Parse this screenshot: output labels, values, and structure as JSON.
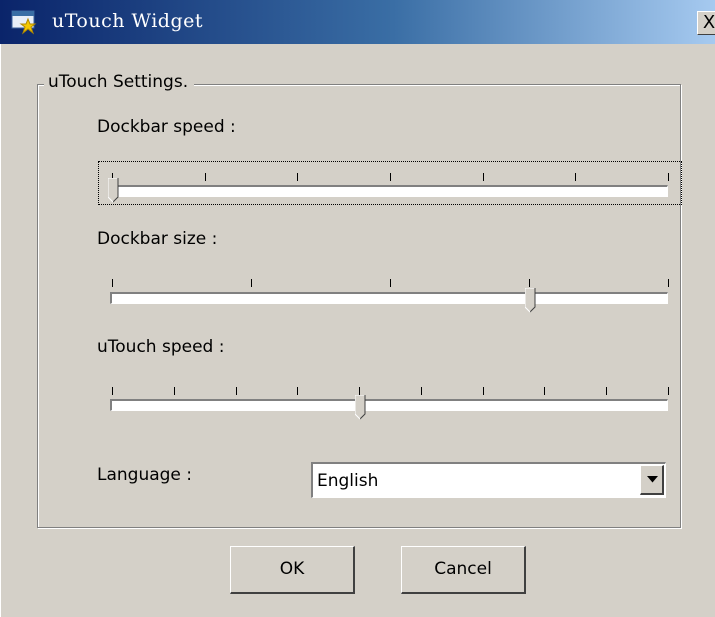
{
  "window": {
    "title": "uTouch Widget",
    "close_glyph": "X"
  },
  "group": {
    "legend": "uTouch Settings."
  },
  "sliders": {
    "dockbar_speed": {
      "label": "Dockbar speed :",
      "value_fraction": 0.0,
      "tick_count": 7
    },
    "dockbar_size": {
      "label": "Dockbar size :",
      "value_fraction": 0.75,
      "tick_count": 5
    },
    "utouch_speed": {
      "label": "uTouch speed :",
      "value_fraction": 0.444,
      "tick_count": 10
    }
  },
  "language": {
    "label": "Language :",
    "selected": "English"
  },
  "buttons": {
    "ok": "OK",
    "cancel": "Cancel"
  },
  "icons": {
    "app": "window-star-icon",
    "close": "close-icon",
    "dropdown": "dropdown-arrow-icon"
  }
}
